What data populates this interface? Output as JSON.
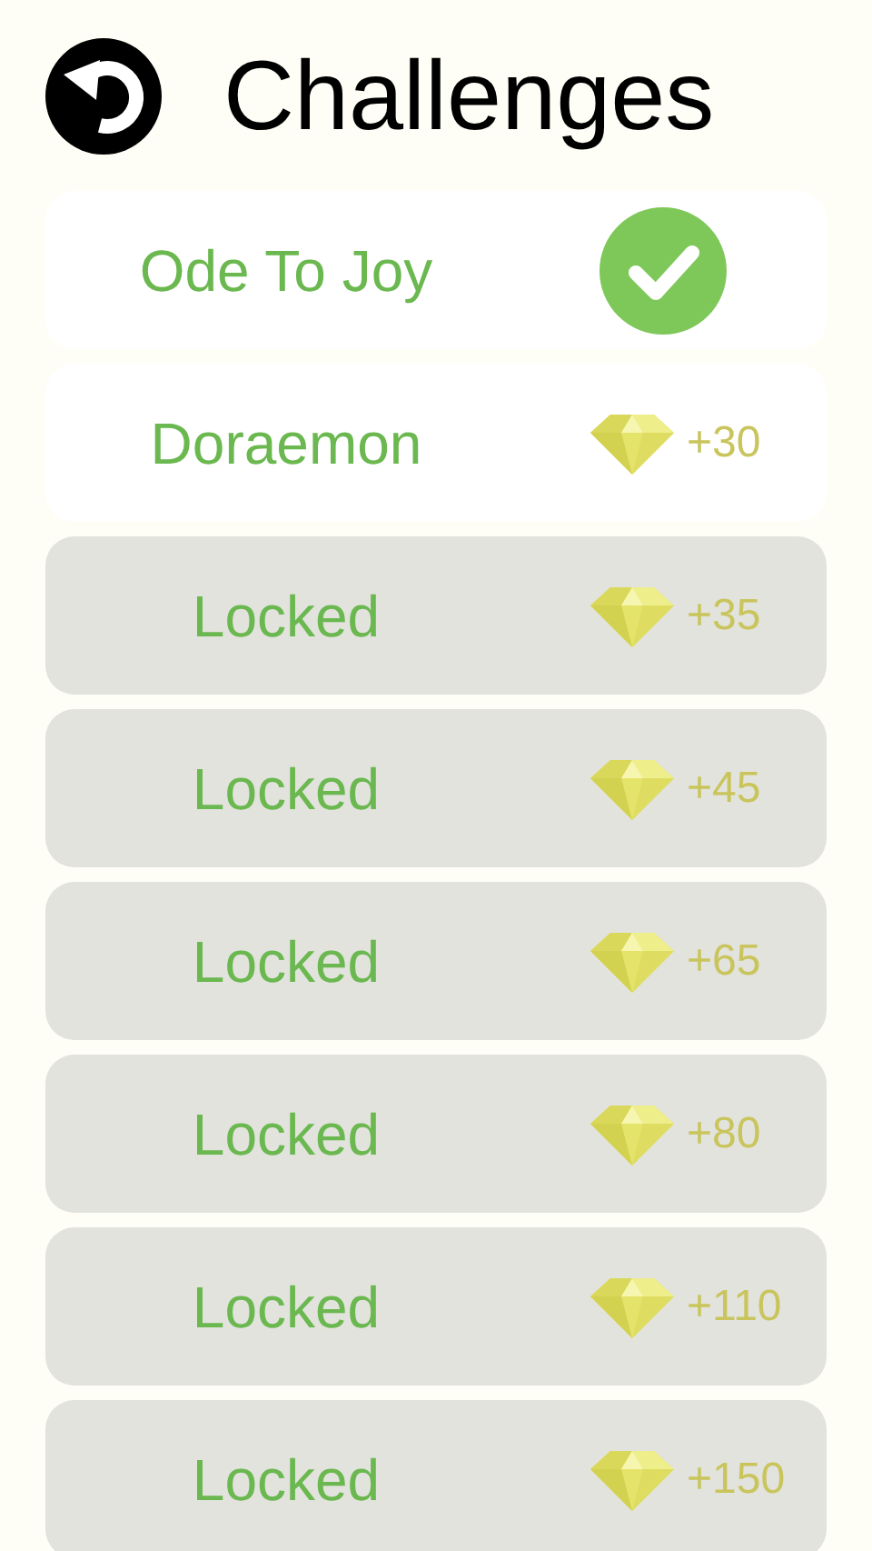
{
  "header": {
    "title": "Challenges"
  },
  "challenges": [
    {
      "name": "Ode To Joy",
      "kind": "completed",
      "locked": false
    },
    {
      "name": "Doraemon",
      "kind": "reward",
      "locked": false,
      "reward": "+30"
    },
    {
      "name": "Locked",
      "kind": "reward",
      "locked": true,
      "reward": "+35"
    },
    {
      "name": "Locked",
      "kind": "reward",
      "locked": true,
      "reward": "+45"
    },
    {
      "name": "Locked",
      "kind": "reward",
      "locked": true,
      "reward": "+65"
    },
    {
      "name": "Locked",
      "kind": "reward",
      "locked": true,
      "reward": "+80"
    },
    {
      "name": "Locked",
      "kind": "reward",
      "locked": true,
      "reward": "+110"
    },
    {
      "name": "Locked",
      "kind": "reward",
      "locked": true,
      "reward": "+150"
    }
  ]
}
